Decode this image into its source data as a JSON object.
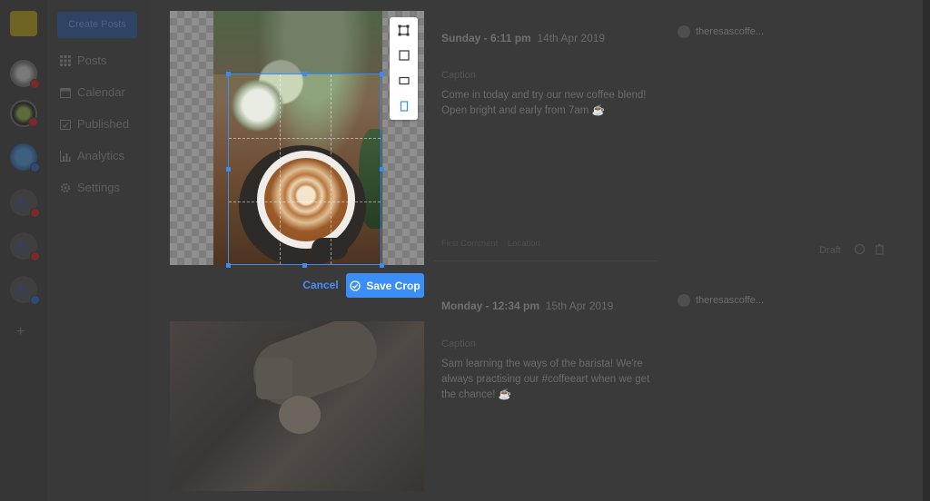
{
  "nav": {
    "create_label": "Create Posts",
    "items": [
      {
        "label": "Posts",
        "icon": "grid-icon"
      },
      {
        "label": "Calendar",
        "icon": "calendar-icon"
      },
      {
        "label": "Published",
        "icon": "calendar-check-icon"
      },
      {
        "label": "Analytics",
        "icon": "bar-chart-icon"
      },
      {
        "label": "Settings",
        "icon": "gear-icon"
      }
    ]
  },
  "rail": {
    "add_label": "+"
  },
  "posts": [
    {
      "day_time": "Sunday - 6:11 pm",
      "date": "14th Apr 2019",
      "caption_label": "Caption",
      "caption_text": "Come in today and try our new coffee blend! Open bright and early from 7am ☕",
      "account": "theresascoffe...",
      "first_comment": "First Comment",
      "location": "Location",
      "status": "Draft"
    },
    {
      "day_time": "Monday - 12:34 pm",
      "date": "15th Apr 2019",
      "caption_label": "Caption",
      "caption_text": "Sam learning the ways of the barista! We're always practising our #coffeeart when we get the chance! ☕",
      "account": "theresascoffe..."
    }
  ],
  "crop": {
    "cancel_label": "Cancel",
    "save_label": "Save Crop",
    "accent_color": "#3a8ef6"
  }
}
